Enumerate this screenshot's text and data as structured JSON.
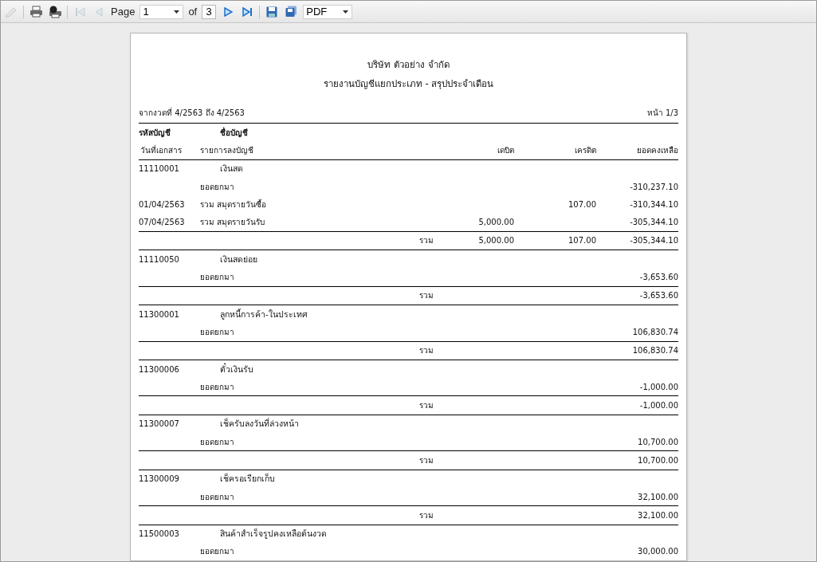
{
  "toolbar": {
    "buttons": [
      {
        "kind": "edit",
        "disabled": true
      },
      {
        "kind": "print",
        "disabled": false
      },
      {
        "kind": "print-page",
        "disabled": false
      },
      {
        "kind": "first",
        "disabled": true
      },
      {
        "kind": "prev",
        "disabled": true
      },
      {
        "kind": "page"
      },
      {
        "kind": "next",
        "disabled": false
      },
      {
        "kind": "last",
        "disabled": false
      },
      {
        "kind": "save",
        "disabled": false
      },
      {
        "kind": "save-as",
        "disabled": false
      },
      {
        "kind": "format"
      }
    ],
    "page_label": "Page",
    "page_value": "1",
    "of_label": "of",
    "page_count": "3",
    "format": "PDF"
  },
  "report": {
    "company": "บริษัท ตัวอย่าง จำกัด",
    "title": "รายงานบัญชีแยกประเภท - สรุปประจำเดือน",
    "period": "จากงวดที่ 4/2563 ถึง 4/2563",
    "page": "หน้า 1/3",
    "headers": {
      "code": "รหัสบัญชี",
      "name": "ชื่อบัญชี",
      "date": "วันที่เอกสาร",
      "description": "รายการลงบัญชี",
      "debit": "เดบิต",
      "credit": "เครดิต",
      "balance": "ยอดคงเหลือ"
    },
    "accounts": [
      {
        "code": "11110001",
        "name": "เงินสด",
        "lines": [
          {
            "description": "ยอดยกมา",
            "balance": "-310,237.10"
          },
          {
            "date": "01/04/2563",
            "description": "รวม สมุดรายวันซื้อ",
            "credit": "107.00",
            "balance": "-310,344.10"
          },
          {
            "date": "07/04/2563",
            "description": "รวม สมุดรายวันรับ",
            "debit": "5,000.00",
            "balance": "-305,344.10"
          }
        ],
        "total": {
          "label": "รวม",
          "debit": "5,000.00",
          "credit": "107.00",
          "balance": "-305,344.10"
        }
      },
      {
        "code": "11110050",
        "name": "เงินสดย่อย",
        "lines": [
          {
            "description": "ยอดยกมา",
            "balance": "-3,653.60"
          }
        ],
        "total": {
          "label": "รวม",
          "balance": "-3,653.60"
        }
      },
      {
        "code": "11300001",
        "name": "ลูกหนี้การค้า-ในประเทศ",
        "lines": [
          {
            "description": "ยอดยกมา",
            "balance": "106,830.74"
          }
        ],
        "total": {
          "label": "รวม",
          "balance": "106,830.74"
        }
      },
      {
        "code": "11300006",
        "name": "ตั๋วเงินรับ",
        "lines": [
          {
            "description": "ยอดยกมา",
            "balance": "-1,000.00"
          }
        ],
        "total": {
          "label": "รวม",
          "balance": "-1,000.00"
        }
      },
      {
        "code": "11300007",
        "name": "เช็ครับลงวันที่ล่วงหน้า",
        "lines": [
          {
            "description": "ยอดยกมา",
            "balance": "10,700.00"
          }
        ],
        "total": {
          "label": "รวม",
          "balance": "10,700.00"
        }
      },
      {
        "code": "11300009",
        "name": "เช็ครอเรียกเก็บ",
        "lines": [
          {
            "description": "ยอดยกมา",
            "balance": "32,100.00"
          }
        ],
        "total": {
          "label": "รวม",
          "balance": "32,100.00"
        }
      },
      {
        "code": "11500003",
        "name": "สินค้าสำเร็จรูปคงเหลือต้นงวด",
        "lines": [
          {
            "description": "ยอดยกมา",
            "balance": "30,000.00"
          }
        ]
      }
    ]
  }
}
